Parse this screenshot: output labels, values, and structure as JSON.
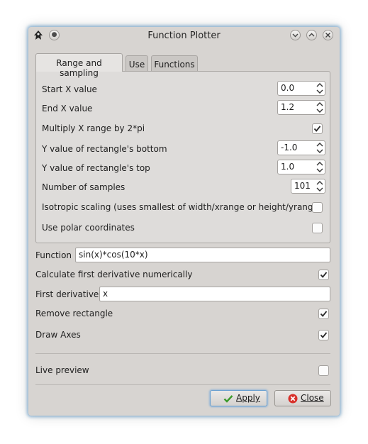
{
  "window": {
    "title": "Function Plotter"
  },
  "tabs": [
    {
      "label": "Range and sampling",
      "active": true
    },
    {
      "label": "Use",
      "active": false
    },
    {
      "label": "Functions",
      "active": false
    }
  ],
  "range": {
    "start_x_label": "Start X value",
    "start_x_value": "0.0",
    "end_x_label": "End X value",
    "end_x_value": "1.2",
    "multiply_label": "Multiply X range by 2*pi",
    "multiply_checked": true,
    "y_bottom_label": "Y value of rectangle's bottom",
    "y_bottom_value": "-1.0",
    "y_top_label": "Y value of rectangle's top",
    "y_top_value": "1.0",
    "samples_label": "Number of samples",
    "samples_value": "101",
    "isotropic_label": "Isotropic scaling (uses smallest of width/xrange or height/yrange)",
    "isotropic_checked": false,
    "polar_label": "Use polar coordinates",
    "polar_checked": false
  },
  "function_label": "Function",
  "function_value": "sin(x)*cos(10*x)",
  "calc_derivative_label": "Calculate first derivative numerically",
  "calc_derivative_checked": true,
  "first_derivative_label": "First derivative",
  "first_derivative_value": "x",
  "remove_rect_label": "Remove rectangle",
  "remove_rect_checked": true,
  "draw_axes_label": "Draw Axes",
  "draw_axes_checked": true,
  "live_preview_label": "Live preview",
  "live_preview_checked": false,
  "buttons": {
    "apply": "Apply",
    "close": "Close"
  },
  "colors": {
    "accent": "#6aa0d0",
    "check": "#2a2a2a",
    "close_red": "#d8302a",
    "apply_green": "#3a9a2a"
  }
}
